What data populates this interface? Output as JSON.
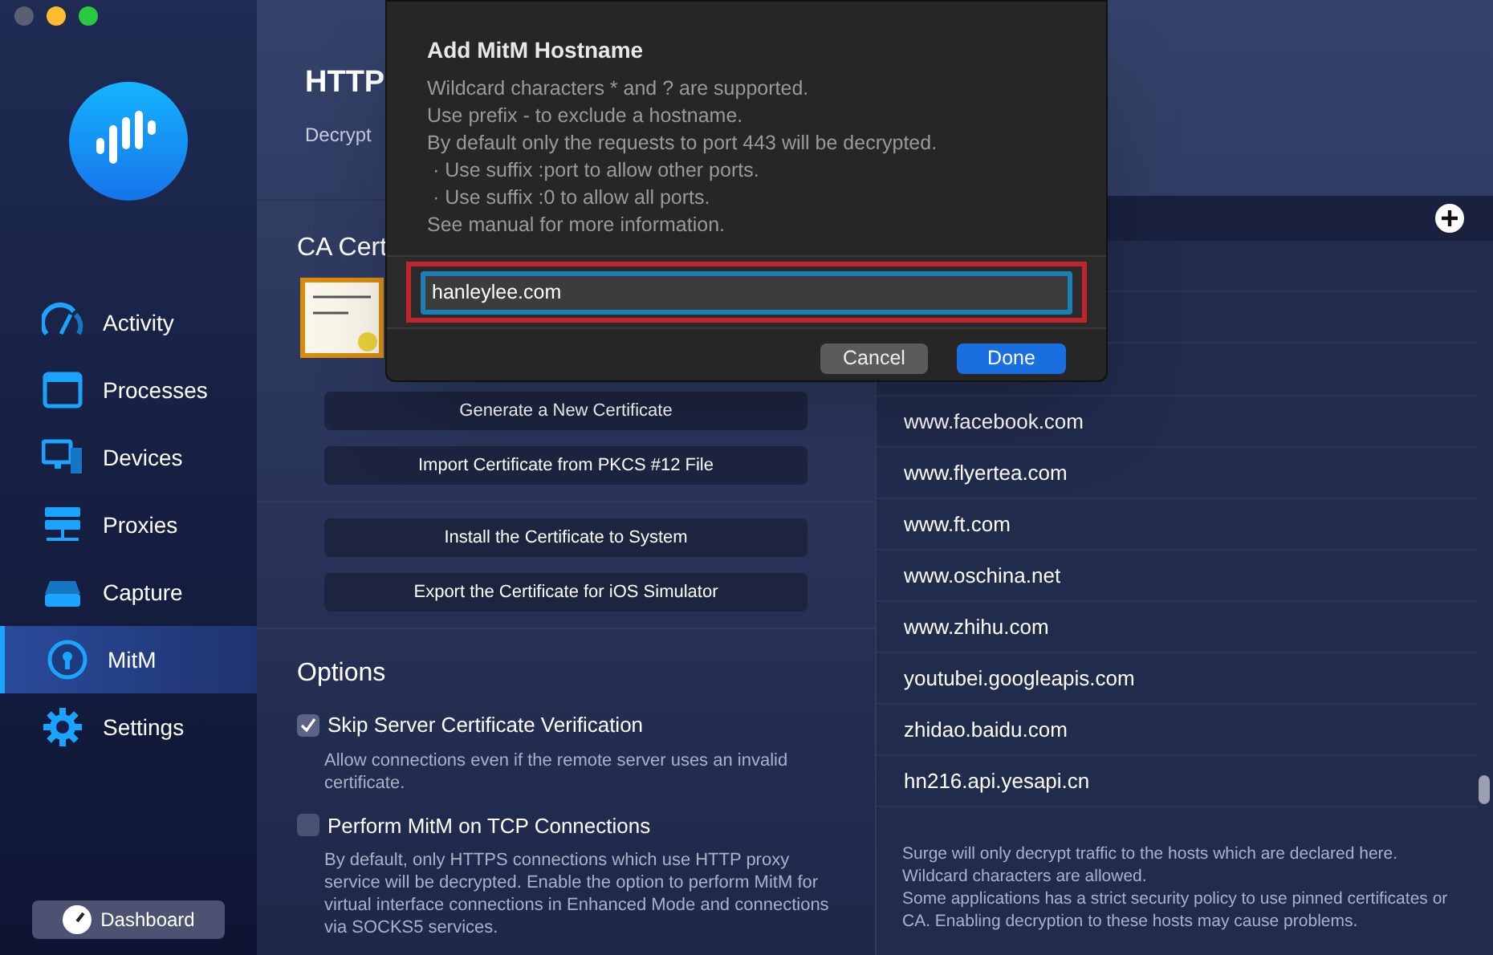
{
  "sidebar": {
    "items": [
      {
        "label": "Activity",
        "selected": false
      },
      {
        "label": "Processes",
        "selected": false
      },
      {
        "label": "Devices",
        "selected": false
      },
      {
        "label": "Proxies",
        "selected": false
      },
      {
        "label": "Capture",
        "selected": false
      },
      {
        "label": "MitM",
        "selected": true
      },
      {
        "label": "Settings",
        "selected": false
      }
    ],
    "dashboard_button": "Dashboard"
  },
  "header": {
    "title": "HTTP",
    "subtitle": "Decrypt"
  },
  "ca_section": {
    "title": "CA Cert",
    "buttons": [
      "Generate a New Certificate",
      "Import Certificate from PKCS #12 File",
      "Install the Certificate to System",
      "Export the Certificate for iOS Simulator"
    ]
  },
  "options": {
    "title": "Options",
    "items": [
      {
        "label": "Skip Server Certificate Verification",
        "checked": true,
        "description": "Allow connections even if the remote server uses an invalid certificate."
      },
      {
        "label": "Perform MitM on TCP Connections",
        "checked": false,
        "description": "By default, only HTTPS connections which use HTTP proxy service will be decrypted. Enable the option to perform MitM for virtual interface connections in Enhanced Mode and connections via SOCKS5 services."
      }
    ]
  },
  "hostnames": {
    "items": [
      "www.facebook.com",
      "www.flyertea.com",
      "www.ft.com",
      "www.oschina.net",
      "www.zhihu.com",
      "youtubei.googleapis.com",
      "zhidao.baidu.com",
      "hn216.api.yesapi.cn"
    ],
    "footer": [
      "Surge will only decrypt traffic to the hosts which are declared here. Wildcard characters are allowed.",
      "Some applications has a strict security policy to use pinned certificates or CA. Enabling decryption to these hosts may cause problems."
    ]
  },
  "dialog": {
    "title": "Add MitM Hostname",
    "lines": [
      "Wildcard characters * and ? are supported.",
      "Use prefix - to exclude a hostname.",
      "By default only the requests to port 443 will be decrypted.",
      " · Use suffix :port to allow other ports.",
      " · Use suffix :0 to allow all ports.",
      "See manual for more information."
    ],
    "value": "hanleylee.com",
    "cancel": "Cancel",
    "done": "Done"
  }
}
